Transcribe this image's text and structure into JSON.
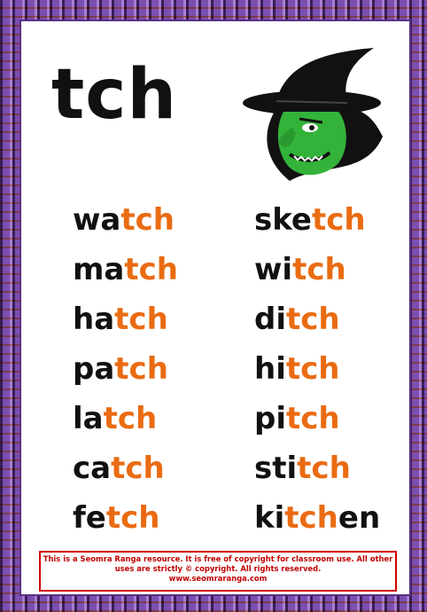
{
  "title": "tch",
  "left_words": [
    {
      "prefix": "wa",
      "tch": "tch",
      "suffix": ""
    },
    {
      "prefix": "ma",
      "tch": "tch",
      "suffix": ""
    },
    {
      "prefix": "ha",
      "tch": "tch",
      "suffix": ""
    },
    {
      "prefix": "pa",
      "tch": "tch",
      "suffix": ""
    },
    {
      "prefix": "la",
      "tch": "tch",
      "suffix": ""
    },
    {
      "prefix": "ca",
      "tch": "tch",
      "suffix": ""
    },
    {
      "prefix": "fe",
      "tch": "tch",
      "suffix": ""
    }
  ],
  "right_words": [
    {
      "prefix": "ske",
      "tch": "tch",
      "suffix": ""
    },
    {
      "prefix": "wi",
      "tch": "tch",
      "suffix": ""
    },
    {
      "prefix": "di",
      "tch": "tch",
      "suffix": ""
    },
    {
      "prefix": "hi",
      "tch": "tch",
      "suffix": ""
    },
    {
      "prefix": "pi",
      "tch": "tch",
      "suffix": ""
    },
    {
      "prefix": "sti",
      "tch": "tch",
      "suffix": ""
    },
    {
      "prefix": "ki",
      "tch": "tch",
      "suffix": "en"
    }
  ],
  "footer": {
    "line1": "This is a Seomra Ranga resource. It is free of copyright for classroom use. All other",
    "line2": "uses are strictly © copyright. All rights reserved.",
    "line3": "www.seomraranga.com"
  },
  "colors": {
    "highlight": "#ea6b12",
    "text": "#111111",
    "footer": "#c00000",
    "border": "#7a4fb0"
  },
  "icons": [
    "witch-icon"
  ]
}
